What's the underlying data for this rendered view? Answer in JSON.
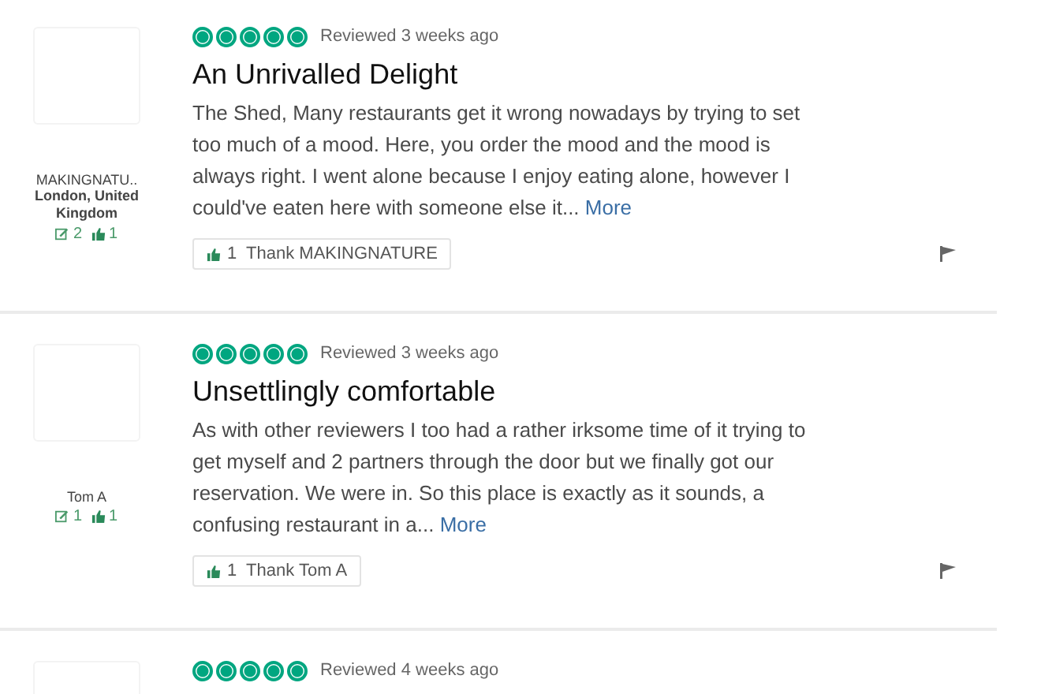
{
  "reviews": [
    {
      "reviewer": {
        "name": "MAKINGNATU..",
        "location": "London, United Kingdom",
        "review_count": "2",
        "helpful_count": "1"
      },
      "stars": 5,
      "date": "Reviewed 3 weeks ago",
      "title": "An Unrivalled Delight",
      "body": "The Shed, Many restaurants get it wrong nowadays by trying to set too much of a mood. Here, you order the mood and the mood is always right. I went alone because I enjoy eating alone, however I could've eaten here with someone else it...",
      "more": "More",
      "thanks": "1",
      "thank_label": "Thank MAKINGNATURE"
    },
    {
      "reviewer": {
        "name": "Tom A",
        "review_count": "1",
        "helpful_count": "1"
      },
      "stars": 5,
      "date": "Reviewed 3 weeks ago",
      "title": "Unsettlingly comfortable",
      "body": "As with other reviewers I too had a rather irksome time of it trying to get myself and 2 partners through the door but we finally got our reservation. We were in. So this place is exactly as it sounds, a confusing restaurant in a...",
      "more": "More",
      "thanks": "1",
      "thank_label": "Thank Tom A"
    },
    {
      "stars": 5,
      "date": "Reviewed 4 weeks ago"
    }
  ]
}
